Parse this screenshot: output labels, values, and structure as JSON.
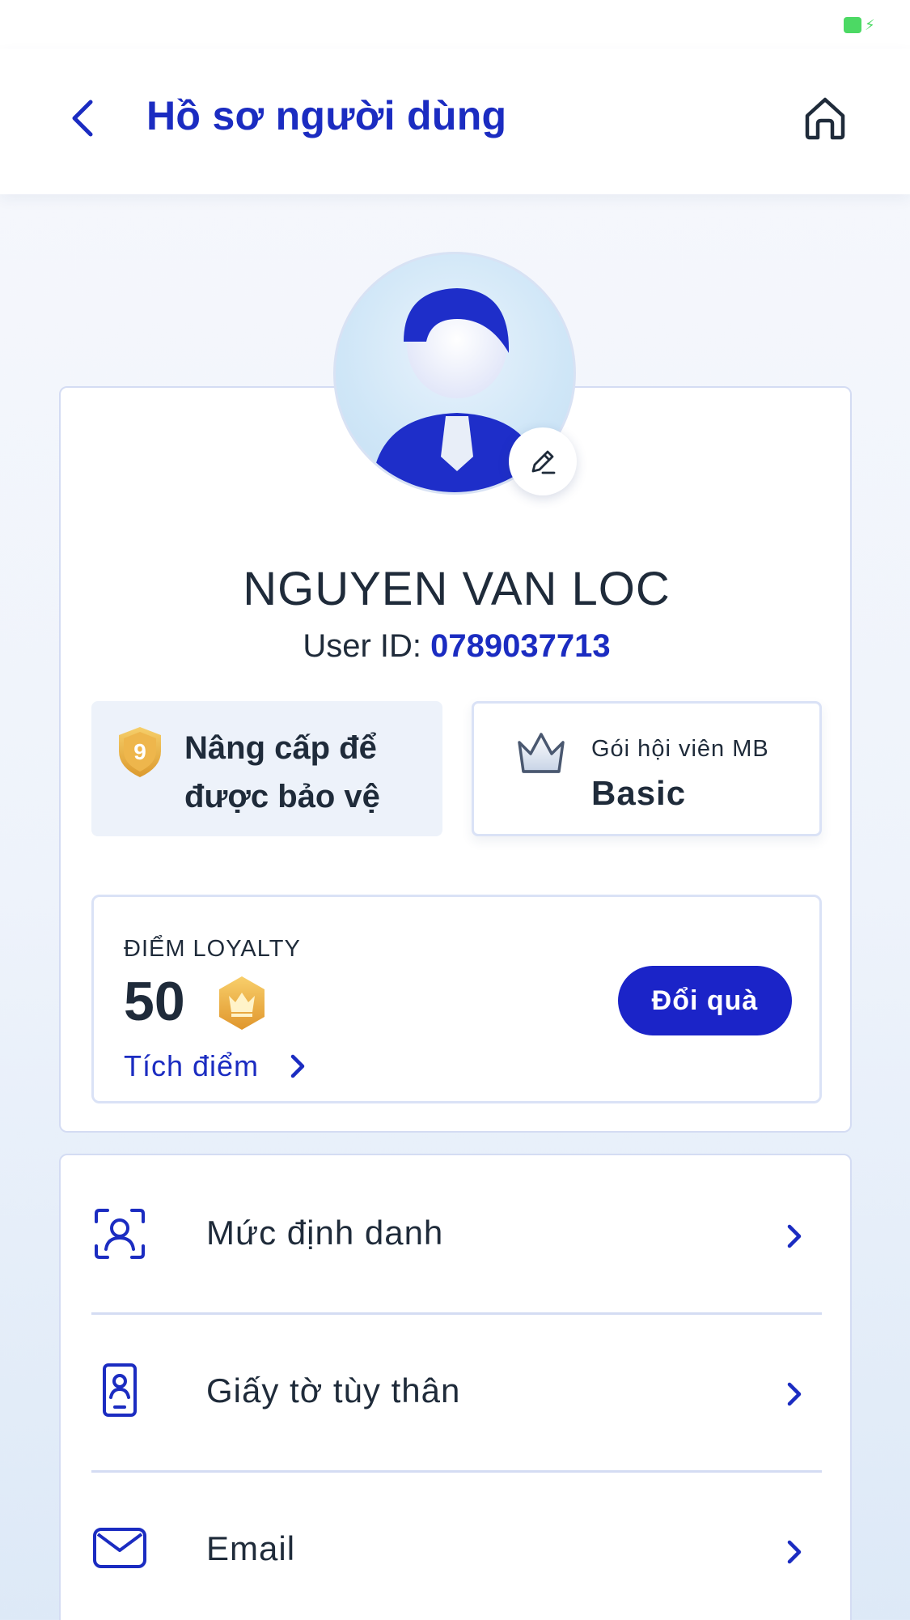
{
  "header": {
    "title": "Hồ sơ người dùng"
  },
  "profile": {
    "name": "NGUYEN VAN LOC",
    "user_id_label": "User ID:",
    "user_id_value": "0789037713"
  },
  "upgrade": {
    "shield_number": "9",
    "text": "Nâng cấp để được bảo vệ"
  },
  "membership": {
    "label": "Gói hội viên MB",
    "tier": "Basic"
  },
  "loyalty": {
    "label": "ĐIỂM LOYALTY",
    "points": "50",
    "earn_label": "Tích điểm",
    "redeem_label": "Đổi quà"
  },
  "menu": {
    "items": [
      {
        "label": "Mức định danh",
        "icon": "identity-scan-icon"
      },
      {
        "label": "Giấy tờ tùy thân",
        "icon": "id-card-icon"
      },
      {
        "label": "Email",
        "icon": "envelope-icon"
      }
    ]
  },
  "colors": {
    "primary": "#1b2cc1",
    "button": "#1b24c8",
    "text": "#1f2b3a",
    "gold": "#e9a93a",
    "battery": "#4cd964"
  }
}
